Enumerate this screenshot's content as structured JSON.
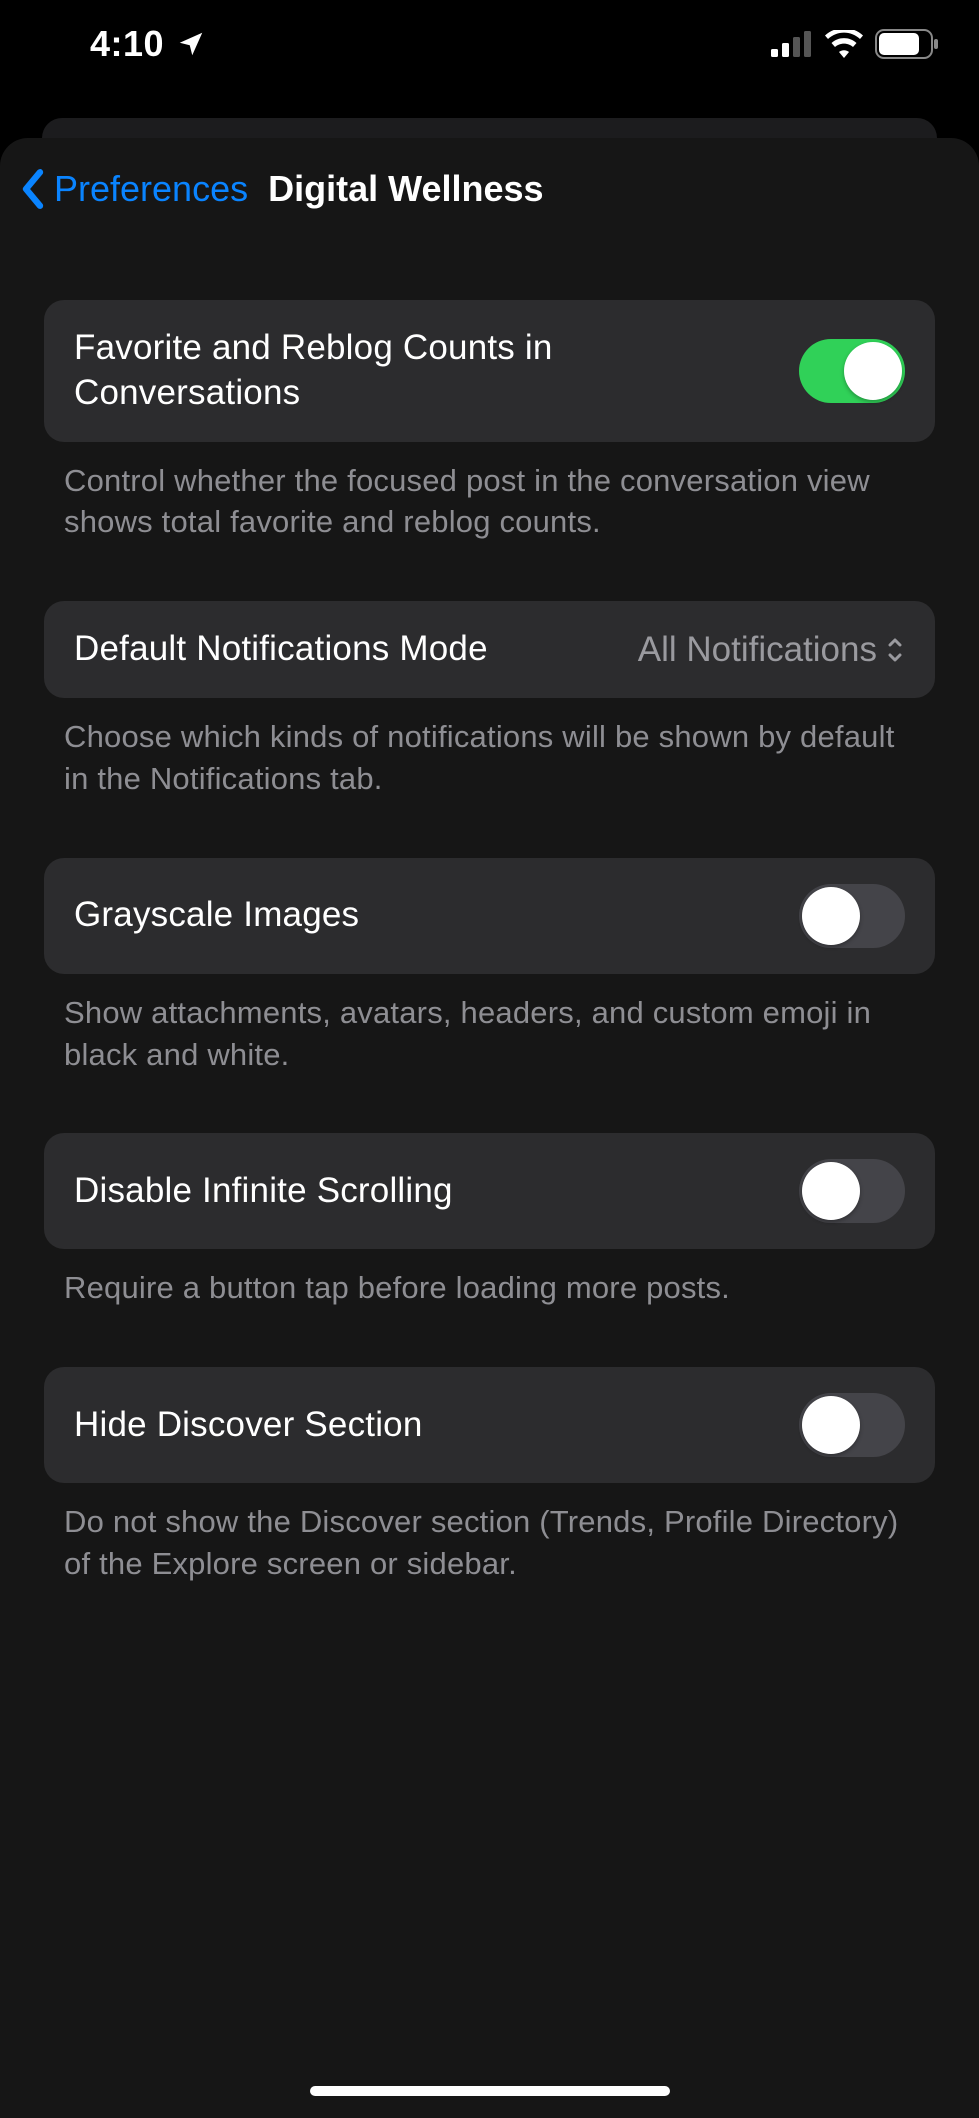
{
  "status_bar": {
    "time": "4:10"
  },
  "nav": {
    "back_label": "Preferences",
    "title": "Digital Wellness"
  },
  "settings": {
    "favorite_reblog": {
      "label": "Favorite and Reblog Counts in Conversations",
      "footer": "Control whether the focused post in the conversation view shows total favorite and reblog counts.",
      "on": true
    },
    "notifications_mode": {
      "label": "Default Notifications Mode",
      "value": "All Notifications",
      "footer": "Choose which kinds of notifications will be shown by default in the Notifications tab."
    },
    "grayscale": {
      "label": "Grayscale Images",
      "footer": "Show attachments, avatars, headers, and custom emoji in black and white.",
      "on": false
    },
    "disable_infinite": {
      "label": "Disable Infinite Scrolling",
      "footer": "Require a button tap before loading more posts.",
      "on": false
    },
    "hide_discover": {
      "label": "Hide Discover Section",
      "footer": "Do not show the Discover section (Trends, Profile Directory) of the Explore screen or sidebar.",
      "on": false
    }
  }
}
